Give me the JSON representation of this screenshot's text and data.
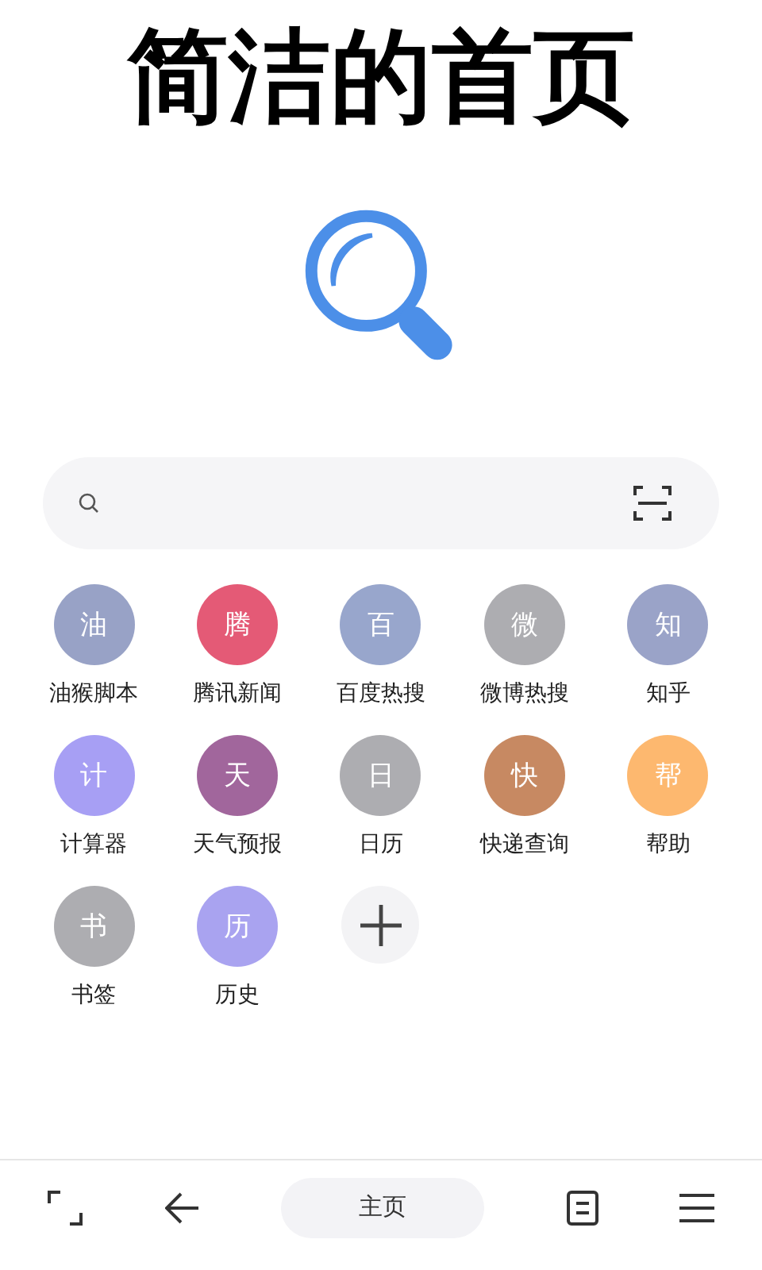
{
  "heading": "简洁的首页",
  "shortcuts": [
    {
      "kind": "site",
      "glyph": "油",
      "label": "油猴脚本",
      "color": "#98a2c6"
    },
    {
      "kind": "site",
      "glyph": "腾",
      "label": "腾讯新闻",
      "color": "#e45a76"
    },
    {
      "kind": "site",
      "glyph": "百",
      "label": "百度热搜",
      "color": "#98a6cc"
    },
    {
      "kind": "site",
      "glyph": "微",
      "label": "微博热搜",
      "color": "#adadb1"
    },
    {
      "kind": "site",
      "glyph": "知",
      "label": "知乎",
      "color": "#9aa3c8"
    },
    {
      "kind": "site",
      "glyph": "计",
      "label": "计算器",
      "color": "#a79ff4"
    },
    {
      "kind": "site",
      "glyph": "天",
      "label": "天气预报",
      "color": "#a1669c"
    },
    {
      "kind": "site",
      "glyph": "日",
      "label": "日历",
      "color": "#adadb1"
    },
    {
      "kind": "site",
      "glyph": "快",
      "label": "快递查询",
      "color": "#c78962"
    },
    {
      "kind": "site",
      "glyph": "帮",
      "label": "帮助",
      "color": "#fdb86f"
    },
    {
      "kind": "site",
      "glyph": "书",
      "label": "书签",
      "color": "#adadb1"
    },
    {
      "kind": "site",
      "glyph": "历",
      "label": "历史",
      "color": "#a9a3f0"
    },
    {
      "kind": "add"
    }
  ],
  "bottom_bar": {
    "home_label": "主页"
  }
}
